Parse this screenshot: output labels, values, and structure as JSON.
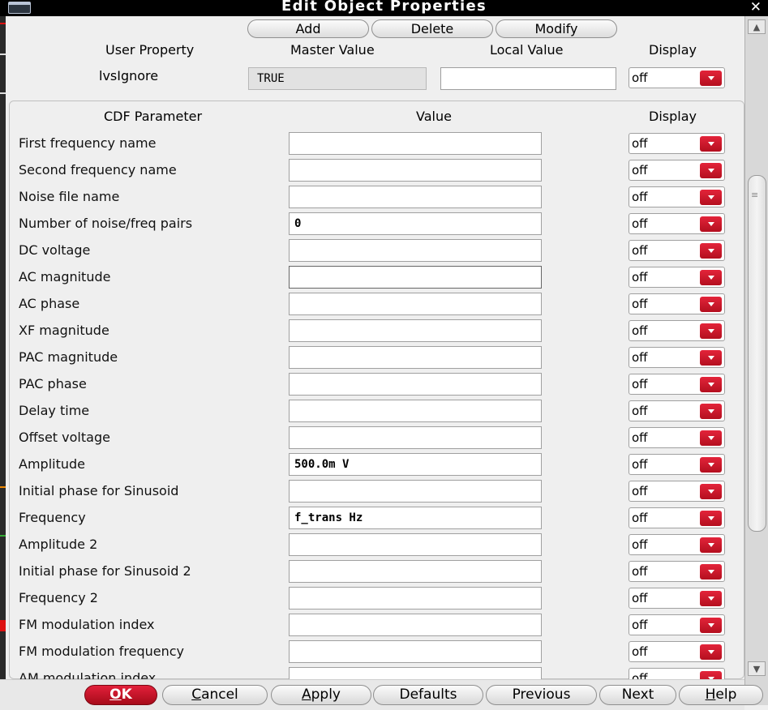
{
  "window": {
    "title": "Edit Object Properties",
    "close_symbol": "✕"
  },
  "toolbar": {
    "add": "Add",
    "delete": "Delete",
    "modify": "Modify"
  },
  "user_section": {
    "headers": {
      "name": "User Property",
      "master": "Master Value",
      "local": "Local Value",
      "display": "Display"
    },
    "property": {
      "name": "lvsIgnore",
      "master_value": "TRUE",
      "local_value": "",
      "display": "off"
    }
  },
  "cdf_section": {
    "headers": {
      "name": "CDF Parameter",
      "value": "Value",
      "display": "Display"
    },
    "params": [
      {
        "label": "First frequency name",
        "value": "",
        "display": "off"
      },
      {
        "label": "Second frequency name",
        "value": "",
        "display": "off"
      },
      {
        "label": "Noise file name",
        "value": "",
        "display": "off"
      },
      {
        "label": "Number of noise/freq pairs",
        "value": "0",
        "display": "off"
      },
      {
        "label": "DC voltage",
        "value": "",
        "display": "off"
      },
      {
        "label": "AC magnitude",
        "value": "",
        "display": "off"
      },
      {
        "label": "AC phase",
        "value": "",
        "display": "off"
      },
      {
        "label": "XF magnitude",
        "value": "",
        "display": "off"
      },
      {
        "label": "PAC magnitude",
        "value": "",
        "display": "off"
      },
      {
        "label": "PAC phase",
        "value": "",
        "display": "off"
      },
      {
        "label": "Delay time",
        "value": "",
        "display": "off"
      },
      {
        "label": "Offset voltage",
        "value": "",
        "display": "off"
      },
      {
        "label": "Amplitude",
        "value": "500.0m V",
        "display": "off"
      },
      {
        "label": "Initial phase for Sinusoid",
        "value": "",
        "display": "off"
      },
      {
        "label": "Frequency",
        "value": "f_trans Hz",
        "display": "off"
      },
      {
        "label": "Amplitude 2",
        "value": "",
        "display": "off"
      },
      {
        "label": "Initial phase for Sinusoid 2",
        "value": "",
        "display": "off"
      },
      {
        "label": "Frequency 2",
        "value": "",
        "display": "off"
      },
      {
        "label": "FM modulation index",
        "value": "",
        "display": "off"
      },
      {
        "label": "FM modulation frequency",
        "value": "",
        "display": "off"
      },
      {
        "label": "AM modulation index",
        "value": "",
        "display": "off"
      }
    ]
  },
  "buttons": {
    "ok": {
      "hot": "O",
      "rest": "K"
    },
    "cancel": {
      "hot": "C",
      "rest": "ancel"
    },
    "apply": {
      "hot": "A",
      "rest": "pply"
    },
    "defaults": "Defaults",
    "previous": "Previous",
    "next": "Next",
    "help": {
      "hot": "H",
      "rest": "elp"
    }
  },
  "colors": {
    "accent_red": "#c8102e",
    "titlebar": "#000000"
  }
}
